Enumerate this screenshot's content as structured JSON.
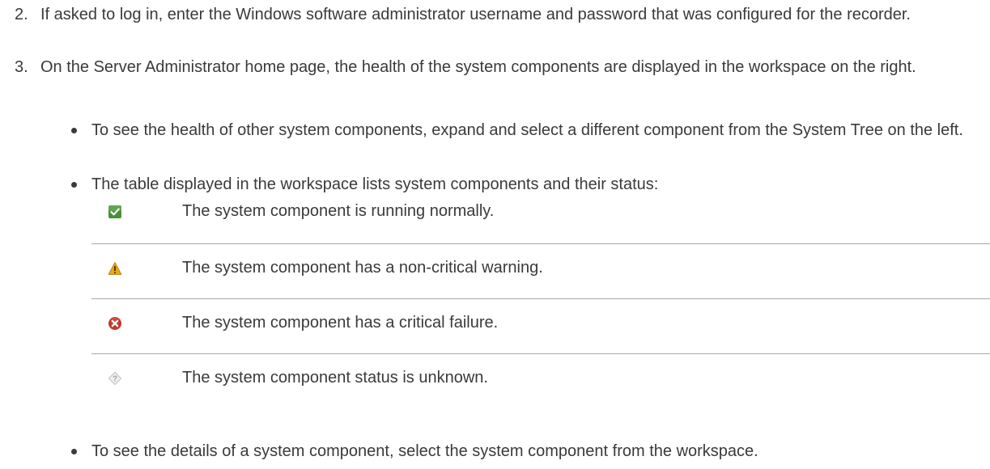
{
  "steps": [
    {
      "number": "2.",
      "text": "If asked to log in, enter the Windows software administrator username and password that was configured for the recorder."
    },
    {
      "number": "3.",
      "text": "On the Server Administrator home page, the health of the system components are displayed in the workspace on the right."
    }
  ],
  "bullets": [
    "To see the health of other system components, expand and select a different component from the System Tree on the left.",
    "The table displayed in the workspace lists system components and their status:",
    "To see the details of a system component, select the system component from the workspace."
  ],
  "status_table": [
    {
      "icon": "check-icon",
      "color": "#4a8f3a",
      "text": "The system component is running normally."
    },
    {
      "icon": "warning-icon",
      "color": "#e8a817",
      "text": "The system component has a non-critical warning."
    },
    {
      "icon": "error-icon",
      "color": "#c0392b",
      "text": "The system component has a critical failure."
    },
    {
      "icon": "unknown-icon",
      "color": "#bdbdbd",
      "text": "The system component status is unknown."
    }
  ]
}
